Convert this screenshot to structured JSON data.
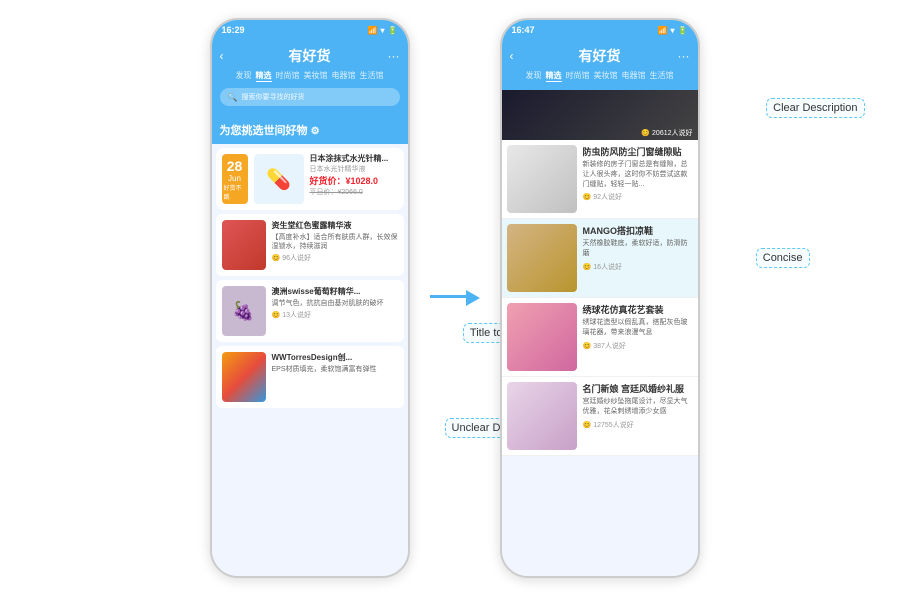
{
  "left_phone": {
    "status_bar": {
      "time": "16:29",
      "signal": "..ll",
      "wifi": "WiFi",
      "battery": "■"
    },
    "header": {
      "back": "‹",
      "title": "有好货",
      "dots": "···"
    },
    "tabs": [
      "发现",
      "精选",
      "时尚馆",
      "美妆馆",
      "电器馆",
      "生活馆"
    ],
    "active_tab": "精选",
    "search_placeholder": "搜索你要寻找的好货",
    "hero_title": "为您挑选世间好物",
    "featured_product": {
      "date": "28",
      "month": "Jun",
      "label": "好货不跳",
      "name": "日本涂抹式水光针精...",
      "sub": "日本水光针精华液",
      "price": "¥1028.0",
      "orig_price": "平日价：¥2066.0"
    },
    "products": [
      {
        "name": "资生堂红色蜜露精华液",
        "desc": "【高度补水】适合所有肤质人群，长效保湿锁水，持续滋润",
        "likes": "96人说好",
        "color": "red"
      },
      {
        "name": "澳洲swisse葡萄籽精华...",
        "desc": "调节气色，抗抗自由基对肌肤的破坏",
        "likes": "13人说好",
        "color": "grape"
      },
      {
        "name": "WWTorresDesign创...",
        "desc": "EPS材质填充，柔软饱满富有弹性",
        "likes": "",
        "color": "cube"
      }
    ],
    "annotations": {
      "title_too_long": "Title too long",
      "unclear_description": "Unclear Description"
    }
  },
  "arrow": "→",
  "right_phone": {
    "status_bar": {
      "time": "16:47",
      "signal": "..ll",
      "wifi": "WiFi",
      "battery": "■"
    },
    "header": {
      "back": "‹",
      "title": "有好货",
      "dots": "···"
    },
    "tabs": [
      "发现",
      "精选",
      "时尚馆",
      "美妆馆",
      "电器馆",
      "生活馆"
    ],
    "active_tab": "精选",
    "top_likes": "20612人说好",
    "products": [
      {
        "name": "防虫防风防尘门窗缝隙贴",
        "desc": "新装修的房子门窗免总是有缝隙，总让人很头疼，这时你不妨尝试这款门缝贴，轻轻一贴...",
        "likes": "92人说好",
        "color": "seals"
      },
      {
        "name": "MANGO搭扣凉鞋",
        "desc": "天然橡胶鞋底，柔软好适，防滑防磨",
        "likes": "16人说好",
        "color": "sandals"
      },
      {
        "name": "绣球花仿真花艺套装",
        "desc": "绣球花造型以假乱真，搭配灰色玻璃花器，带来浪漫气息",
        "likes": "387人说好",
        "color": "flowers"
      },
      {
        "name": "名门新娘 宫廷风婚纱礼服",
        "desc": "宫廷婚纱纱坠拖尾设计，尽显大气优雅，花朵刺绣增添少女感",
        "likes": "12755人说好",
        "color": "dress"
      }
    ],
    "annotations": {
      "clear_description": "Clear Description",
      "concise": "Concise"
    }
  }
}
